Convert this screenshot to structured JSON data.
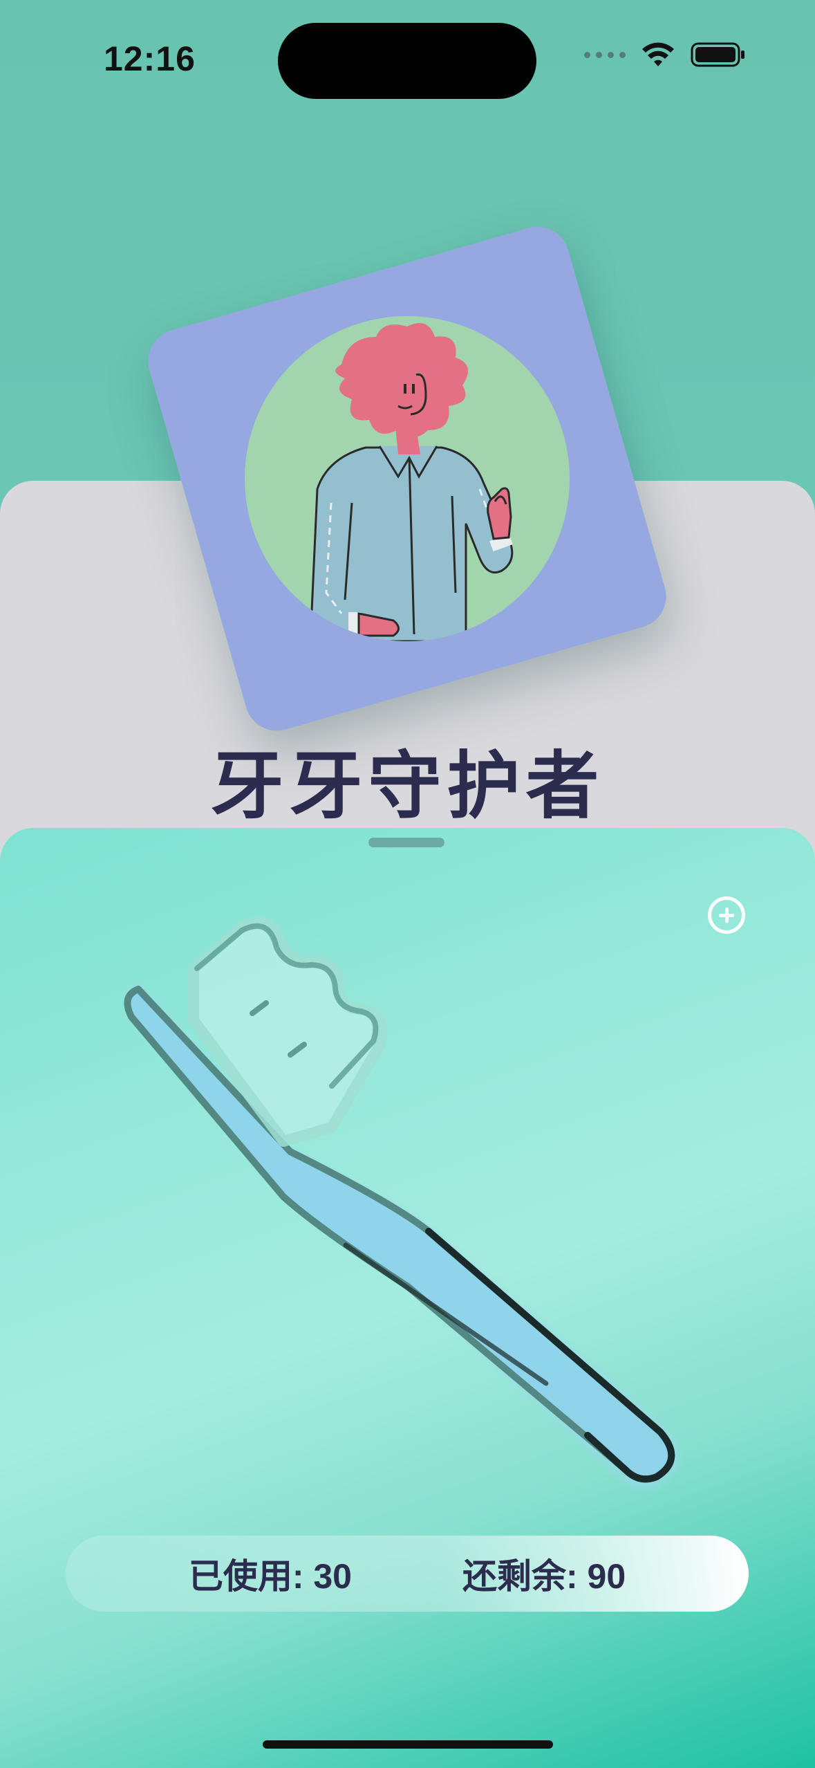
{
  "status_bar": {
    "time": "12:16",
    "icons": [
      "signal-dots-icon",
      "wifi-icon",
      "battery-icon"
    ]
  },
  "header": {
    "title": "牙牙守护者",
    "avatar": "character-illustration"
  },
  "sheet": {
    "add_icon": "plus-circle-icon",
    "illustration": "toothbrush-icon",
    "stats": {
      "used": "已使用: 30",
      "remaining": "还剩余: 90"
    }
  },
  "colors": {
    "background": "#68c3b0",
    "card": "#95a9e0",
    "avatar_bg": "#a2d5ad",
    "title": "#2c2c4e",
    "sheet_accent": "#1ec1a3",
    "brush_handle": "#8ed3ec"
  }
}
